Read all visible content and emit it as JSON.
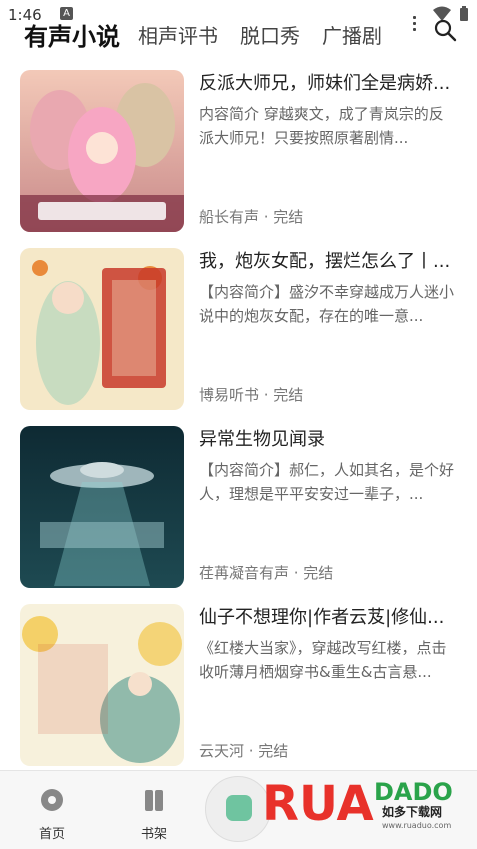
{
  "status_bar": {
    "time": "1:46",
    "notification_letter": "A"
  },
  "tabs": [
    {
      "label": "有声小说",
      "active": true
    },
    {
      "label": "相声评书",
      "active": false
    },
    {
      "label": "脱口秀",
      "active": false
    },
    {
      "label": "广播剧",
      "active": false
    }
  ],
  "books": [
    {
      "title": "反派大师兄，师妹们全是病娇...",
      "description": "内容简介 穿越爽文，成了青岚宗的反派大师兄！只要按照原著剧情...",
      "meta": "船长有声 · 完结"
    },
    {
      "title": "我，炮灰女配，摆烂怎么了丨...",
      "description": "【内容简介】盛汐不幸穿越成万人迷小说中的炮灰女配，存在的唯一意...",
      "meta": "博易听书 · 完结"
    },
    {
      "title": "异常生物见闻录",
      "description": "【内容简介】郝仁，人如其名，是个好人，理想是平平安安过一辈子，...",
      "meta": "荏苒凝音有声 · 完结"
    },
    {
      "title": "仙子不想理你|作者云芨|修仙...",
      "description": "《红楼大当家》，穿越改写红楼，点击收听薄月栖烟穿书&重生&古言悬...",
      "meta": "云天河 · 完结"
    }
  ],
  "bottom_nav": {
    "home_label": "首页",
    "shelf_label": "书架"
  },
  "watermark": {
    "brand": "RUAODAO",
    "cn": "如多下载网",
    "url": "www.ruaduo.com"
  },
  "colors": {
    "accent_green": "#6fc4a0",
    "watermark_red": "#e8312a"
  }
}
